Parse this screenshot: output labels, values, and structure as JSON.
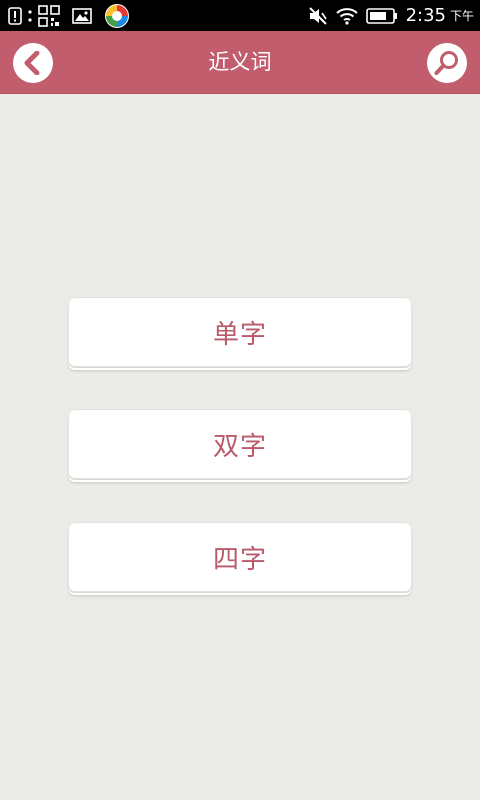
{
  "status_bar": {
    "time": "2:35",
    "ampm": "下午",
    "notification_icons": [
      "alert-icon",
      "qr-code-icon",
      "image-icon",
      "app-logo-icon"
    ],
    "system_icons": [
      "mute-icon",
      "wifi-icon",
      "battery-icon"
    ]
  },
  "header": {
    "title": "近义词",
    "back_icon": "back-arrow-icon",
    "search_icon": "search-icon",
    "background_color": "#c25d6e"
  },
  "menu": {
    "items": [
      {
        "label": "单字"
      },
      {
        "label": "双字"
      },
      {
        "label": "四字"
      }
    ],
    "text_color": "#b9596b"
  }
}
